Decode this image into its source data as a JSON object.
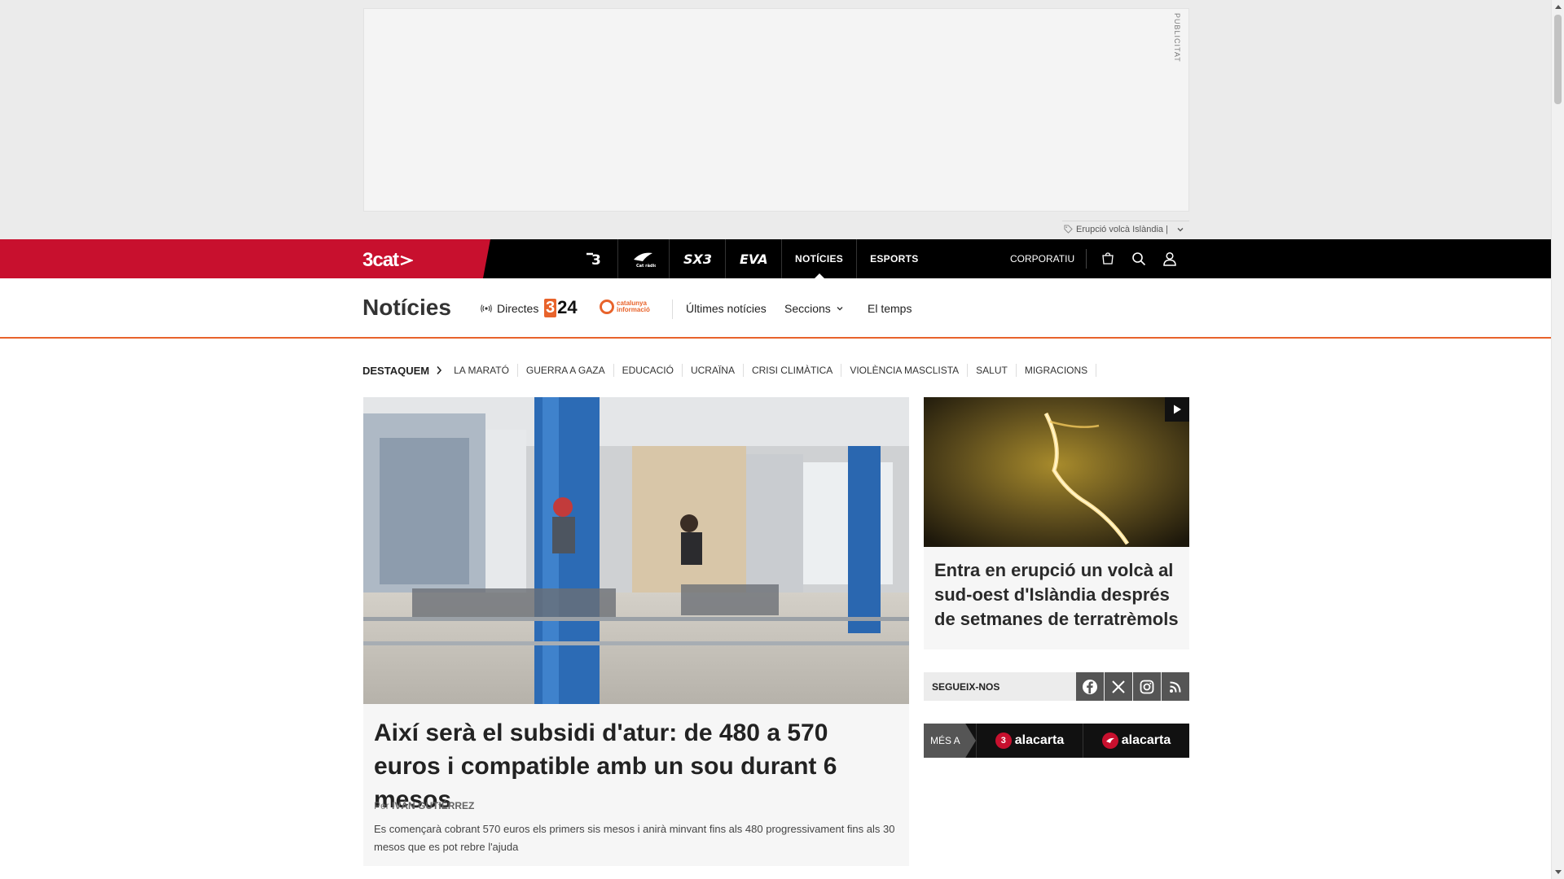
{
  "ad": {
    "label": "PUBLICITAT"
  },
  "trending": {
    "text": "Erupció volcà Islàndia |"
  },
  "topnav": {
    "logo": "3cat",
    "channels": [
      {
        "label": "3",
        "icon": "tv3-logo"
      },
      {
        "label": "Cat ràdio",
        "icon": "catradio-logo"
      },
      {
        "label": "SX3",
        "icon": "sx3-logo"
      },
      {
        "label": "EVA",
        "icon": "eva-logo"
      },
      {
        "label": "NOTÍCIES",
        "icon": ""
      },
      {
        "label": "ESPORTS",
        "icon": ""
      }
    ],
    "corporate": "CORPORATIU",
    "icons": [
      "cart-icon",
      "search-icon",
      "user-icon"
    ]
  },
  "section": {
    "title": "Notícies",
    "directes": "Directes",
    "logo_324": "24",
    "logo_catinf_line1": "catalunya",
    "logo_catinf_line2": "informació",
    "links": [
      "Últimes notícies",
      "Seccions",
      "El temps"
    ]
  },
  "highlights": {
    "label": "DESTAQUEM",
    "items": [
      "LA MARATÓ",
      "GUERRA A GAZA",
      "EDUCACIÓ",
      "UCRAÏNA",
      "CRISI CLIMÀTICA",
      "VIOLÈNCIA MASCLISTA",
      "SALUT",
      "MIGRACIONS"
    ]
  },
  "main_article": {
    "title": "Així serà el subsidi d'atur: de 480 a 570 euros i compatible amb un sou durant 6 mesos",
    "byline_prefix": "Per",
    "author": "IVÁN GUTIÉRREZ",
    "summary": "Es començarà cobrant 570 euros els primers sis mesos i anirà minvant fins als 480 progressivament fins als 30 mesos que es pot rebre l'ajuda"
  },
  "side_article": {
    "title": "Entra en erupció un volcà al sud-oest d'Islàndia després de setmanes de terratrèmols"
  },
  "follow": {
    "label": "SEGUEIX-NOS",
    "networks": [
      "facebook-icon",
      "x-icon",
      "instagram-icon",
      "rss-icon"
    ]
  },
  "alacarta": {
    "label": "MÉS A",
    "brand_1": "alacarta",
    "brand_2": "alacarta",
    "brand_1_mark": "3"
  },
  "colors": {
    "brand_red": "#c8102e",
    "accent_orange": "#e8632b",
    "nav_black": "#000000"
  }
}
